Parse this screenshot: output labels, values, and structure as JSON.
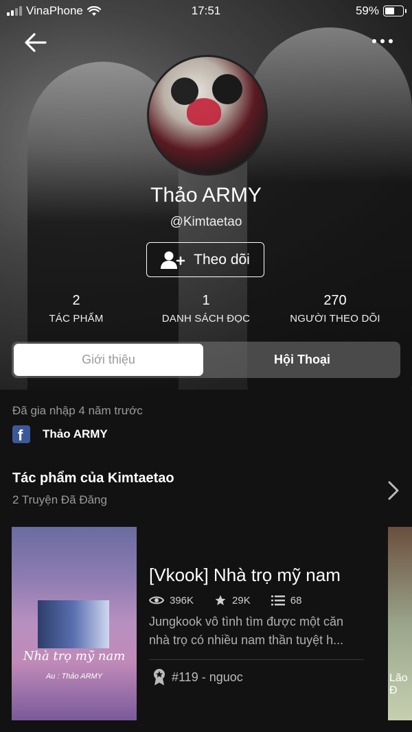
{
  "status_bar": {
    "carrier": "VinaPhone",
    "time": "17:51",
    "battery": "59%"
  },
  "profile": {
    "name": "Thảo ARMY",
    "handle": "@Kimtaetao",
    "follow_label": "Theo dõi",
    "stats": [
      {
        "value": "2",
        "label": "TÁC PHẨM"
      },
      {
        "value": "1",
        "label": "DANH SÁCH ĐỌC"
      },
      {
        "value": "270",
        "label": "NGƯỜI THEO DÕI"
      }
    ]
  },
  "tabs": [
    {
      "label": "Giới thiệu"
    },
    {
      "label": "Hội Thoại"
    }
  ],
  "about": {
    "joined": "Đã gia nhập 4 năm trước",
    "facebook_name": "Thảo ARMY"
  },
  "works": {
    "title": "Tác phẩm của Kimtaetao",
    "subtitle": "2 Truyện Đã Đăng",
    "items": [
      {
        "title": "[Vkook] Nhà trọ mỹ nam",
        "views": "396K",
        "votes": "29K",
        "parts": "68",
        "description": "Jungkook vô tình tìm được một căn nhà trọ có nhiều nam thần tuyệt h...",
        "rank": "#119 - nguoc",
        "cover_title": "Nhà trọ mỹ nam",
        "cover_author": "Au : Thảo ARMY"
      }
    ],
    "next_cover_text": "Lão Đ"
  },
  "colors": {
    "background": "#121212",
    "facebook": "#3b5998",
    "muted": "#9a9a9a"
  }
}
